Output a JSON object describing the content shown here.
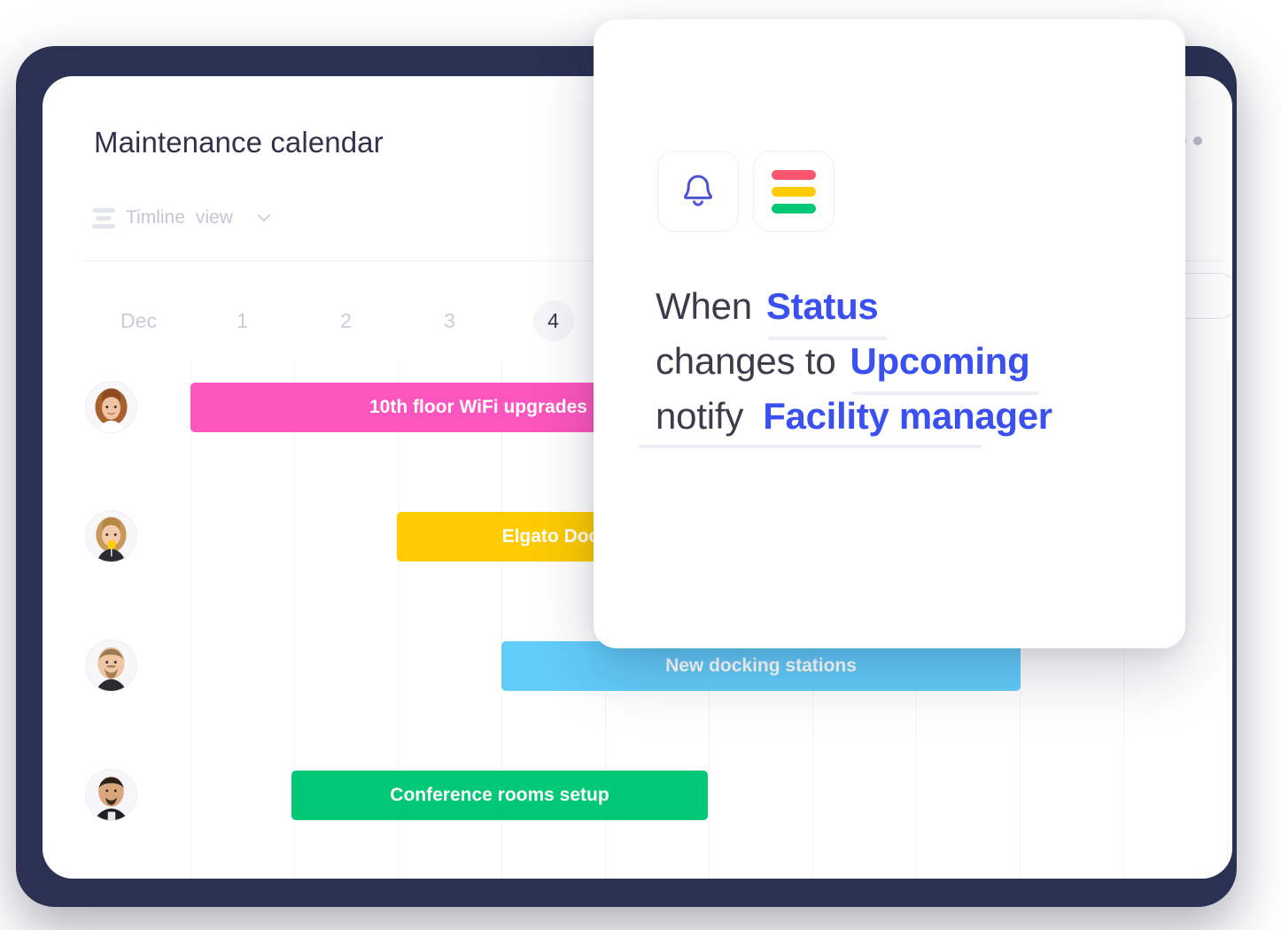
{
  "app": {
    "title": "Maintenance calendar"
  },
  "toolbar": {
    "view_label": "Timline",
    "view_sub": "view",
    "chevron_icon": "chevron-down-icon",
    "menu_icon": "more-horizontal-icon",
    "list_icon": "list-view-icon"
  },
  "calendar": {
    "dates": [
      {
        "label": "Dec",
        "today": false
      },
      {
        "label": "1",
        "today": false
      },
      {
        "label": "2",
        "today": false
      },
      {
        "label": "3",
        "today": false
      },
      {
        "label": "4",
        "today": true
      }
    ],
    "rows": [
      {
        "avatar": "avatar-woman-red-hair",
        "task": {
          "label": "10th floor WiFi upgrades",
          "color": "#fc55be",
          "color_name": "pink"
        }
      },
      {
        "avatar": "avatar-woman-blonde",
        "task": {
          "label": "Elgato Docking",
          "color": "#fdcb00",
          "color_name": "yellow"
        }
      },
      {
        "avatar": "avatar-man-beard",
        "task": {
          "label": "New docking stations",
          "color": "#62ccfb",
          "color_name": "blue"
        }
      },
      {
        "avatar": "avatar-man-dark-shirt",
        "task": {
          "label": "Conference rooms setup",
          "color": "#00c875",
          "color_name": "green"
        }
      }
    ]
  },
  "modal": {
    "icons": {
      "bell": "bell-icon",
      "bars": "colored-bars-icon"
    },
    "bar_colors": {
      "top": "#f8566f",
      "middle": "#ffcb00",
      "bottom": "#00c875"
    },
    "sentence": {
      "line1_plain": "When",
      "line1_chip": "Status",
      "line2_plain": "changes to",
      "line2_chip": "Upcoming",
      "line3_plain": "notify",
      "line3_chip": "Facility manager"
    },
    "accent_color": "#3b50f0"
  },
  "theme": {
    "backdrop": "#2a3153",
    "card": "#ffffff",
    "title_color": "#32334a",
    "muted": "#c3c6d4",
    "gridline": "#f2f3f7"
  }
}
